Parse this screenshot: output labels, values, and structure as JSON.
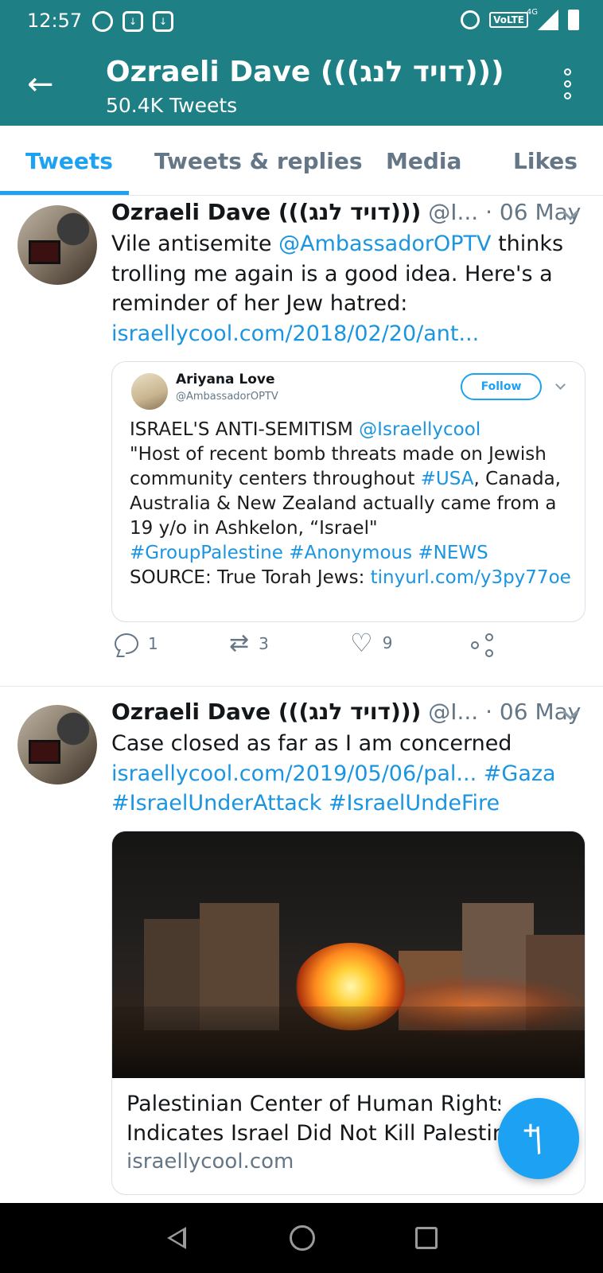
{
  "status_bar": {
    "time": "12:57",
    "network": "4G",
    "volte": "VoLTE"
  },
  "header": {
    "title": "Ozraeli Dave (((דויד לנג)))",
    "subtitle": "50.4K Tweets"
  },
  "tabs": [
    "Tweets",
    "Tweets & replies",
    "Media",
    "Likes"
  ],
  "tweets": [
    {
      "name": "Ozraeli Dave (((דויד לנג)))",
      "handle": "@I...",
      "date": "· 06 May",
      "text_before": "Vile antisemite ",
      "mention": "@AmbassadorOPTV",
      "text_after": " thinks trolling me again is a good idea. Here's a reminder of her Jew hatred:",
      "link": "israellycool.com/2018/02/20/ant...",
      "quote": {
        "name": "Ariyana Love",
        "handle": "@AmbassadorOPTV",
        "follow_label": "Follow",
        "text_1": "ISRAEL'S ANTI-SEMITISM ",
        "mention": "@Israellycool",
        "text_2": "\"Host of recent bomb threats made on Jewish community centers throughout ",
        "hashtag_usa": "#USA",
        "text_3": ", Canada, Australia & New Zealand actually came from a 19 y/o in Ashkelon, “Israel\"",
        "hashtags": "#GroupPalestine #Anonymous #NEWS",
        "text_4": "SOURCE: True Torah Jews: ",
        "link": "tinyurl.com/y3py77oe"
      },
      "replies": "1",
      "retweets": "3",
      "likes": "9"
    },
    {
      "name": "Ozraeli Dave (((דויד לנג)))",
      "handle": "@I...",
      "date": "· 06 May",
      "text": "Case closed as far as I am concerned",
      "link": "israellycool.com/2019/05/06/pal...",
      "hashtags_1": "#Gaza",
      "hashtags_2": "#IsraelUnderAttack #IsraelUndeFire",
      "card": {
        "title_line1": "Palestinian Center of Human Rights",
        "title_line2": "Indicates Israel Did Not Kill Palestin",
        "domain": "israellycool.com"
      }
    }
  ],
  "fab": {
    "icon": "compose-tweet-icon"
  },
  "colors": {
    "header": "#1e7f84",
    "accent": "#1da1f2",
    "link": "#1b95e0",
    "muted": "#657786"
  }
}
